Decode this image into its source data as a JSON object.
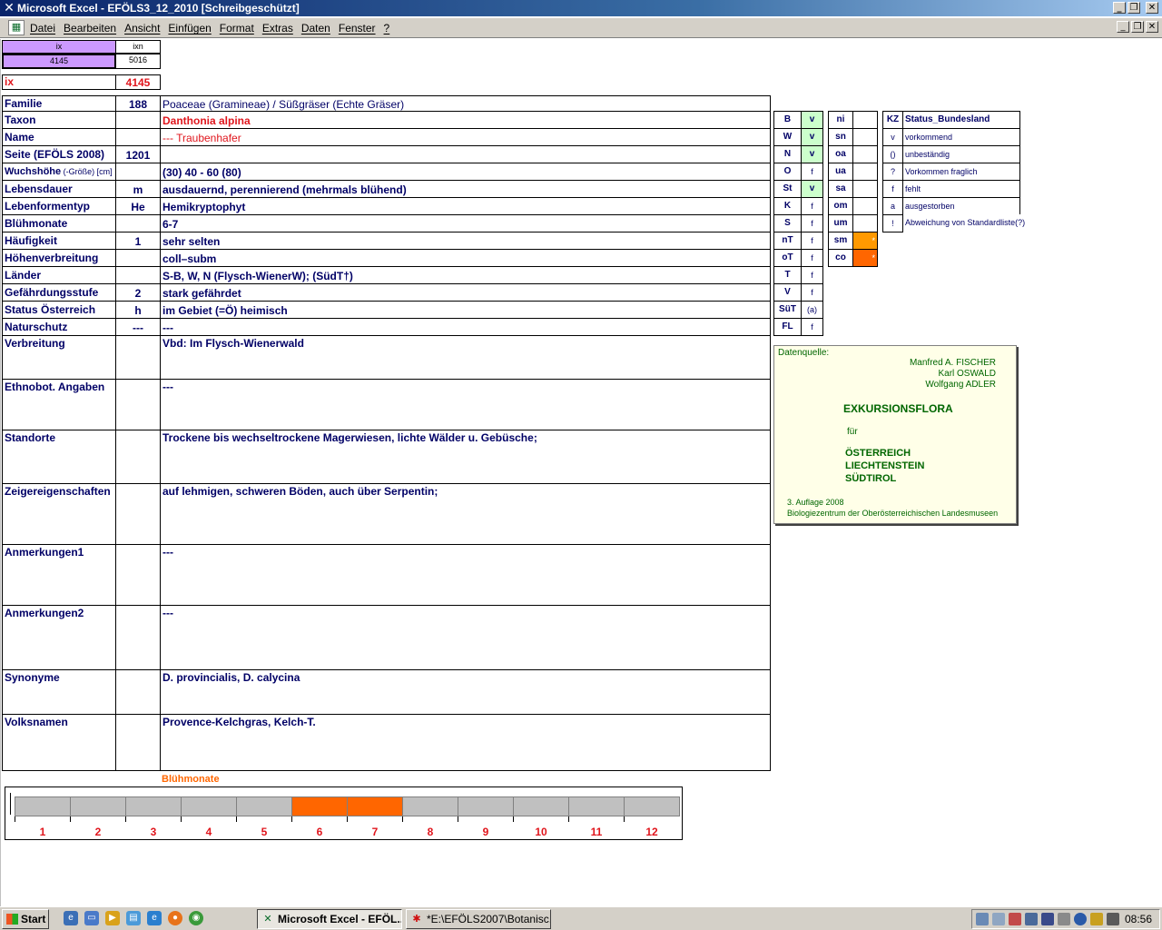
{
  "window": {
    "title": "Microsoft Excel - EFÖLS3_12_2010  [Schreibgeschützt]",
    "app_icon": "excel-x-icon"
  },
  "menu": [
    "Datei",
    "Bearbeiten",
    "Ansicht",
    "Einfügen",
    "Format",
    "Extras",
    "Daten",
    "Fenster",
    "?"
  ],
  "index": {
    "ix_header": "ix",
    "ixn_header": "ixn",
    "ix_value": "4145",
    "ixn_value": "5016",
    "ix_label": "ix",
    "ix_big": "4145"
  },
  "rows": [
    {
      "label": "Familie",
      "code": "188",
      "value": "Poaceae (Gramineae)  /  Süßgräser (Echte Gräser)"
    },
    {
      "label": "Taxon",
      "code": "",
      "value": "Danthonia alpina"
    },
    {
      "label": "Name",
      "code": "",
      "value": "--- Traubenhafer"
    },
    {
      "label": "Seite (EFÖLS 2008)",
      "code": "1201",
      "value": ""
    },
    {
      "label": "Wuchshöhe",
      "label_sub": " (-Größe) [cm]",
      "code": "",
      "value": "(30) 40 - 60 (80)"
    },
    {
      "label": "Lebensdauer",
      "code": "m",
      "value": "ausdauernd, perennierend (mehrmals blühend)"
    },
    {
      "label": "Lebenformentyp",
      "code": "He",
      "value": "Hemikryptophyt"
    },
    {
      "label": "Blühmonate",
      "code": "",
      "value": "6-7"
    },
    {
      "label": "Häufigkeit",
      "code": "1",
      "value": "sehr selten"
    },
    {
      "label": "Höhenverbreitung",
      "code": "",
      "value": "coll–subm"
    },
    {
      "label": "Länder",
      "code": "",
      "value": "S-B, W, N (Flysch-WienerW); (SüdT†)"
    },
    {
      "label": "Gefährdungsstufe",
      "code": "2",
      "value": "stark gefährdet"
    },
    {
      "label": "Status Österreich",
      "code": "h",
      "value": "im Gebiet (=Ö) heimisch"
    },
    {
      "label": "Naturschutz",
      "code": "---",
      "value": "---"
    },
    {
      "label": "Verbreitung",
      "code": "",
      "value": "Vbd:  Im Flysch-Wienerwald"
    },
    {
      "label": "Ethnobot. Angaben",
      "code": "",
      "value": "---"
    },
    {
      "label": "Standorte",
      "code": "",
      "value": "Trockene bis wechseltrockene Magerwiesen, lichte Wälder u. Gebüsche;"
    },
    {
      "label": "Zeigereigenschaften",
      "code": "",
      "value": "auf lehmigen, schweren Böden, auch über Serpentin;"
    },
    {
      "label": "Anmerkungen1",
      "code": "",
      "value": "---"
    },
    {
      "label": "Anmerkungen2",
      "code": "",
      "value": "---"
    },
    {
      "label": "Synonyme",
      "code": "",
      "value": "D. provincialis, D. calycina"
    },
    {
      "label": "Volksnamen",
      "code": "",
      "value": "Provence-Kelchgras, Kelch-T."
    }
  ],
  "bundeslaender": [
    {
      "kz": "B",
      "v": "v"
    },
    {
      "kz": "W",
      "v": "v"
    },
    {
      "kz": "N",
      "v": "v"
    },
    {
      "kz": "O",
      "v": "f"
    },
    {
      "kz": "St",
      "v": "v"
    },
    {
      "kz": "K",
      "v": "f"
    },
    {
      "kz": "S",
      "v": "f"
    },
    {
      "kz": "nT",
      "v": "f"
    },
    {
      "kz": "oT",
      "v": "f"
    },
    {
      "kz": "T",
      "v": "f"
    },
    {
      "kz": "V",
      "v": "f"
    },
    {
      "kz": "SüT",
      "v": "(a)"
    },
    {
      "kz": "FL",
      "v": "f"
    }
  ],
  "hoehenstufen": [
    {
      "kz": "ni",
      "v": ""
    },
    {
      "kz": "sn",
      "v": ""
    },
    {
      "kz": "oa",
      "v": ""
    },
    {
      "kz": "ua",
      "v": ""
    },
    {
      "kz": "sa",
      "v": ""
    },
    {
      "kz": "om",
      "v": ""
    },
    {
      "kz": "um",
      "v": ""
    },
    {
      "kz": "sm",
      "v": "*"
    },
    {
      "kz": "co",
      "v": "*"
    }
  ],
  "legend": {
    "kz_header": "KZ",
    "status_header": "Status_Bundesland",
    "items": [
      {
        "kz": "v",
        "text": "vorkommend"
      },
      {
        "kz": "()",
        "text": "unbeständig"
      },
      {
        "kz": "?",
        "text": "Vorkommen fraglich"
      },
      {
        "kz": "f",
        "text": "fehlt"
      },
      {
        "kz": "a",
        "text": "ausgestorben"
      },
      {
        "kz": "!",
        "text": "Abweichung von Standardliste(?)"
      }
    ]
  },
  "quelle": {
    "header": "Datenquelle:",
    "author1": "Manfred A. FISCHER",
    "author2": "Karl OSWALD",
    "author3": "Wolfgang ADLER",
    "title": "EXKURSIONSFLORA",
    "fuer": "für",
    "country1": "ÖSTERREICH",
    "country2": "LIECHTENSTEIN",
    "country3": "SÜDTIROL",
    "edition": "3. Auflage 2008",
    "publisher": "Biologiezentrum der Oberösterreichischen Landesmuseen"
  },
  "bluehmonate": {
    "title": "Blühmonate",
    "months": [
      "1",
      "2",
      "3",
      "4",
      "5",
      "6",
      "7",
      "8",
      "9",
      "10",
      "11",
      "12"
    ],
    "active": [
      6,
      7
    ],
    "colors": {
      "active": "#ff6600",
      "inactive": "#c0c0c0"
    }
  },
  "taskbar": {
    "start": "Start",
    "items": [
      {
        "label": "Microsoft Excel - EFÖL...",
        "active": true
      },
      {
        "label": "*E:\\EFÖLS2007\\Botanisc...",
        "active": false
      }
    ],
    "clock": "08:56"
  }
}
